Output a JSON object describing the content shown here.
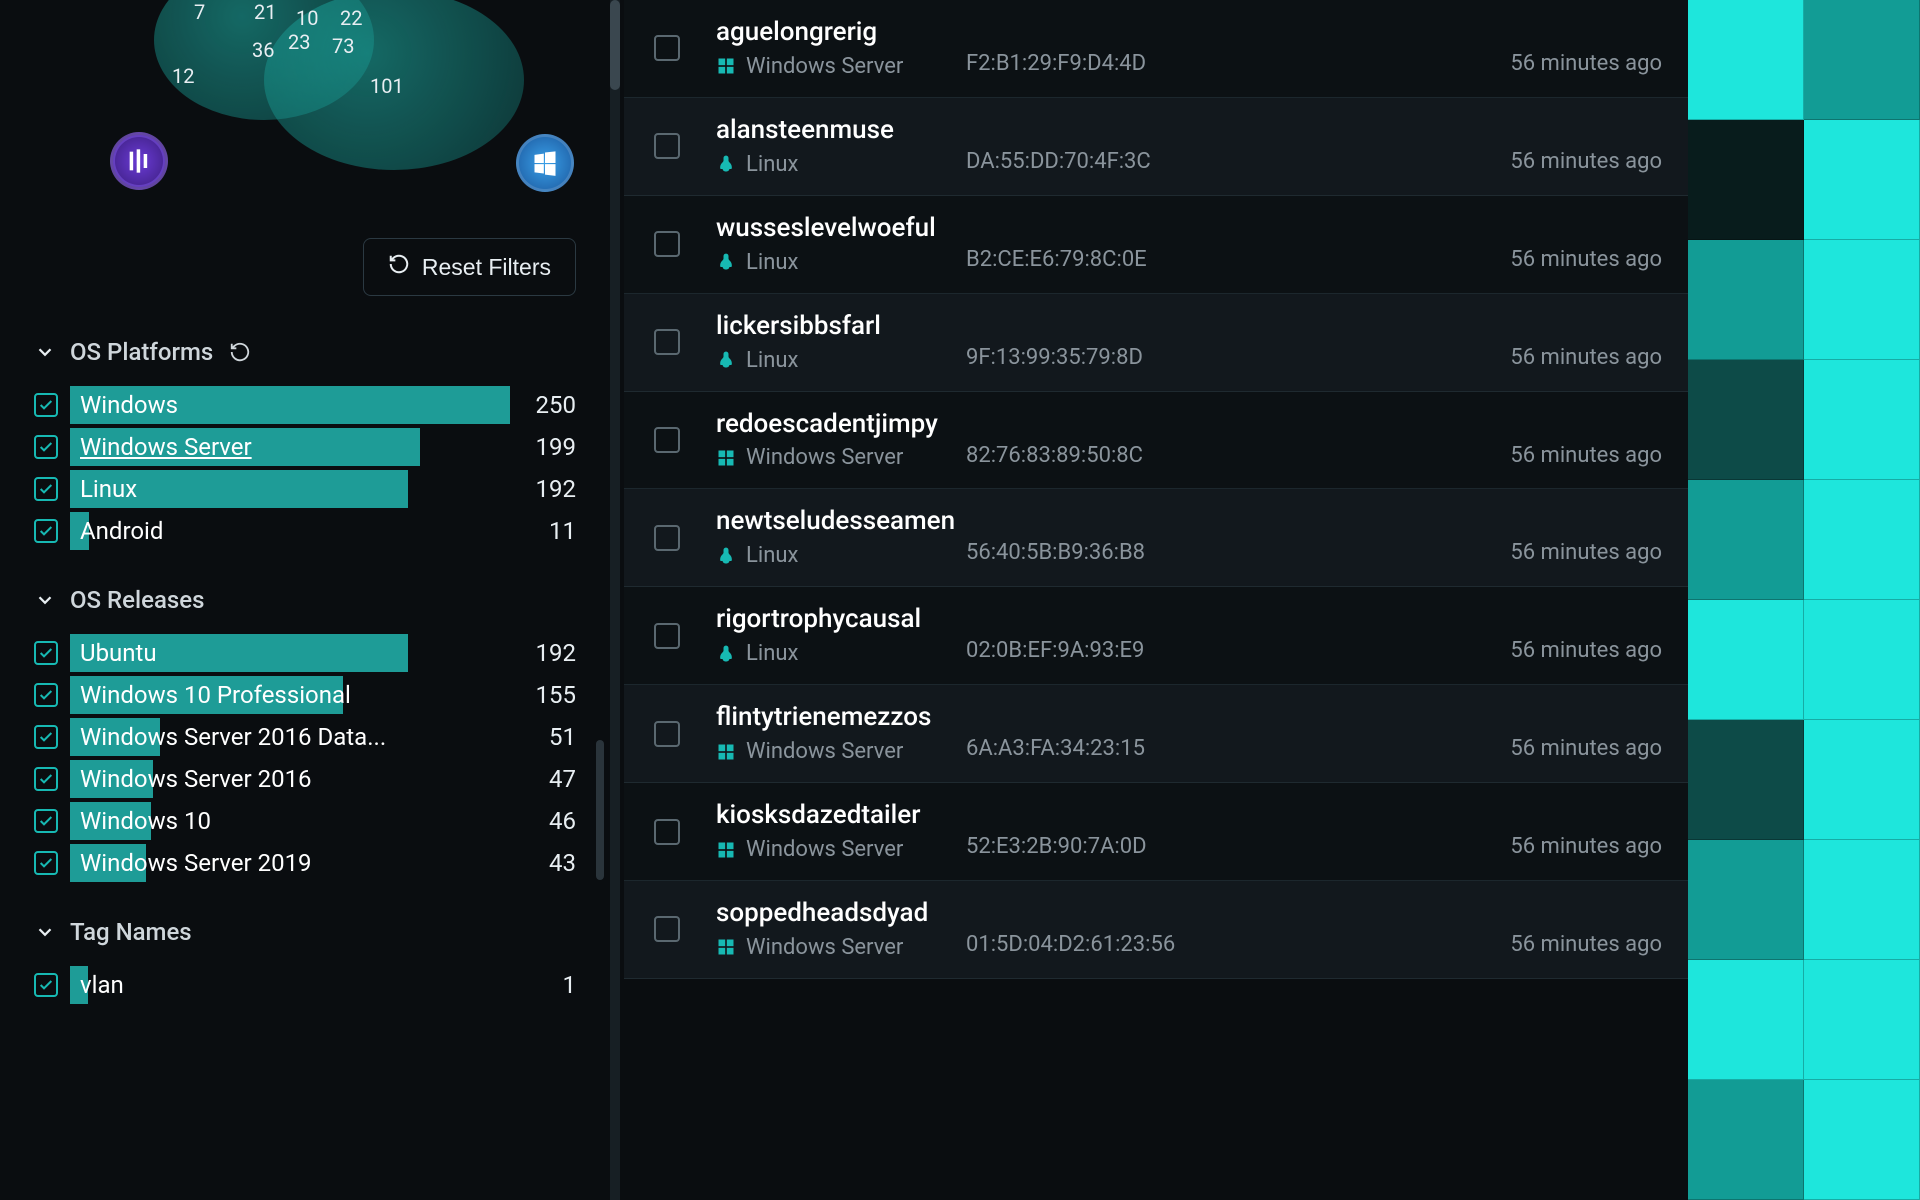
{
  "colors": {
    "accent": "#17b9b3"
  },
  "sidebar": {
    "topo": {
      "labels": [
        "7",
        "21",
        "10",
        "22",
        "23",
        "36",
        "73",
        "12",
        "101"
      ],
      "positions": [
        {
          "l": 160,
          "t": 0
        },
        {
          "l": 220,
          "t": 0
        },
        {
          "l": 262,
          "t": 6
        },
        {
          "l": 306,
          "t": 6
        },
        {
          "l": 254,
          "t": 30
        },
        {
          "l": 218,
          "t": 38
        },
        {
          "l": 298,
          "t": 34
        },
        {
          "l": 138,
          "t": 64
        },
        {
          "l": 336,
          "t": 74
        }
      ]
    },
    "reset_label": "Reset Filters",
    "facets": [
      {
        "title": "OS Platforms",
        "has_reset": true,
        "max": 250,
        "items": [
          {
            "label": "Windows",
            "count": 250,
            "checked": true,
            "hover": false
          },
          {
            "label": "Windows Server",
            "count": 199,
            "checked": true,
            "hover": true
          },
          {
            "label": "Linux",
            "count": 192,
            "checked": true,
            "hover": false
          },
          {
            "label": "Android",
            "count": 11,
            "checked": true,
            "hover": false
          }
        ]
      },
      {
        "title": "OS Releases",
        "has_reset": false,
        "max": 250,
        "items": [
          {
            "label": "Ubuntu",
            "count": 192,
            "checked": true
          },
          {
            "label": "Windows 10 Professional",
            "count": 155,
            "checked": true
          },
          {
            "label": "Windows Server 2016 Data...",
            "count": 51,
            "checked": true
          },
          {
            "label": "Windows Server 2016",
            "count": 47,
            "checked": true
          },
          {
            "label": "Windows 10",
            "count": 46,
            "checked": true
          },
          {
            "label": "Windows Server 2019",
            "count": 43,
            "checked": true
          }
        ]
      },
      {
        "title": "Tag Names",
        "has_reset": false,
        "max": 250,
        "items": [
          {
            "label": "vlan",
            "count": 1,
            "checked": true
          }
        ]
      }
    ]
  },
  "hosts": [
    {
      "name": "aguelongrerig",
      "os": "Windows Server",
      "os_kind": "win",
      "mac": "F2:B1:29:F9:D4:4D",
      "age": "56 minutes ago"
    },
    {
      "name": "alansteenmuse",
      "os": "Linux",
      "os_kind": "linux",
      "mac": "DA:55:DD:70:4F:3C",
      "age": "56 minutes ago"
    },
    {
      "name": "wusseslevelwoeful",
      "os": "Linux",
      "os_kind": "linux",
      "mac": "B2:CE:E6:79:8C:0E",
      "age": "56 minutes ago"
    },
    {
      "name": "lickersibbsfarl",
      "os": "Linux",
      "os_kind": "linux",
      "mac": "9F:13:99:35:79:8D",
      "age": "56 minutes ago"
    },
    {
      "name": "redoescadentjimpy",
      "os": "Windows Server",
      "os_kind": "win",
      "mac": "82:76:83:89:50:8C",
      "age": "56 minutes ago"
    },
    {
      "name": "newtseludesseamen",
      "os": "Linux",
      "os_kind": "linux",
      "mac": "56:40:5B:B9:36:B8",
      "age": "56 minutes ago"
    },
    {
      "name": "rigortrophycausal",
      "os": "Linux",
      "os_kind": "linux",
      "mac": "02:0B:EF:9A:93:E9",
      "age": "56 minutes ago"
    },
    {
      "name": "flintytrienemezzos",
      "os": "Windows Server",
      "os_kind": "win",
      "mac": "6A:A3:FA:34:23:15",
      "age": "56 minutes ago"
    },
    {
      "name": "kiosksdazedtailer",
      "os": "Windows Server",
      "os_kind": "win",
      "mac": "52:E3:2B:90:7A:0D",
      "age": "56 minutes ago"
    },
    {
      "name": "soppedheadsdyad",
      "os": "Windows Server",
      "os_kind": "win",
      "mac": "01:5D:04:D2:61:23:56",
      "age": "56 minutes ago"
    }
  ],
  "heat": [
    [
      3,
      2
    ],
    [
      0,
      3
    ],
    [
      2,
      3
    ],
    [
      1,
      3
    ],
    [
      2,
      3
    ],
    [
      3,
      3
    ],
    [
      1,
      3
    ],
    [
      2,
      3
    ],
    [
      3,
      3
    ],
    [
      2,
      3
    ]
  ]
}
